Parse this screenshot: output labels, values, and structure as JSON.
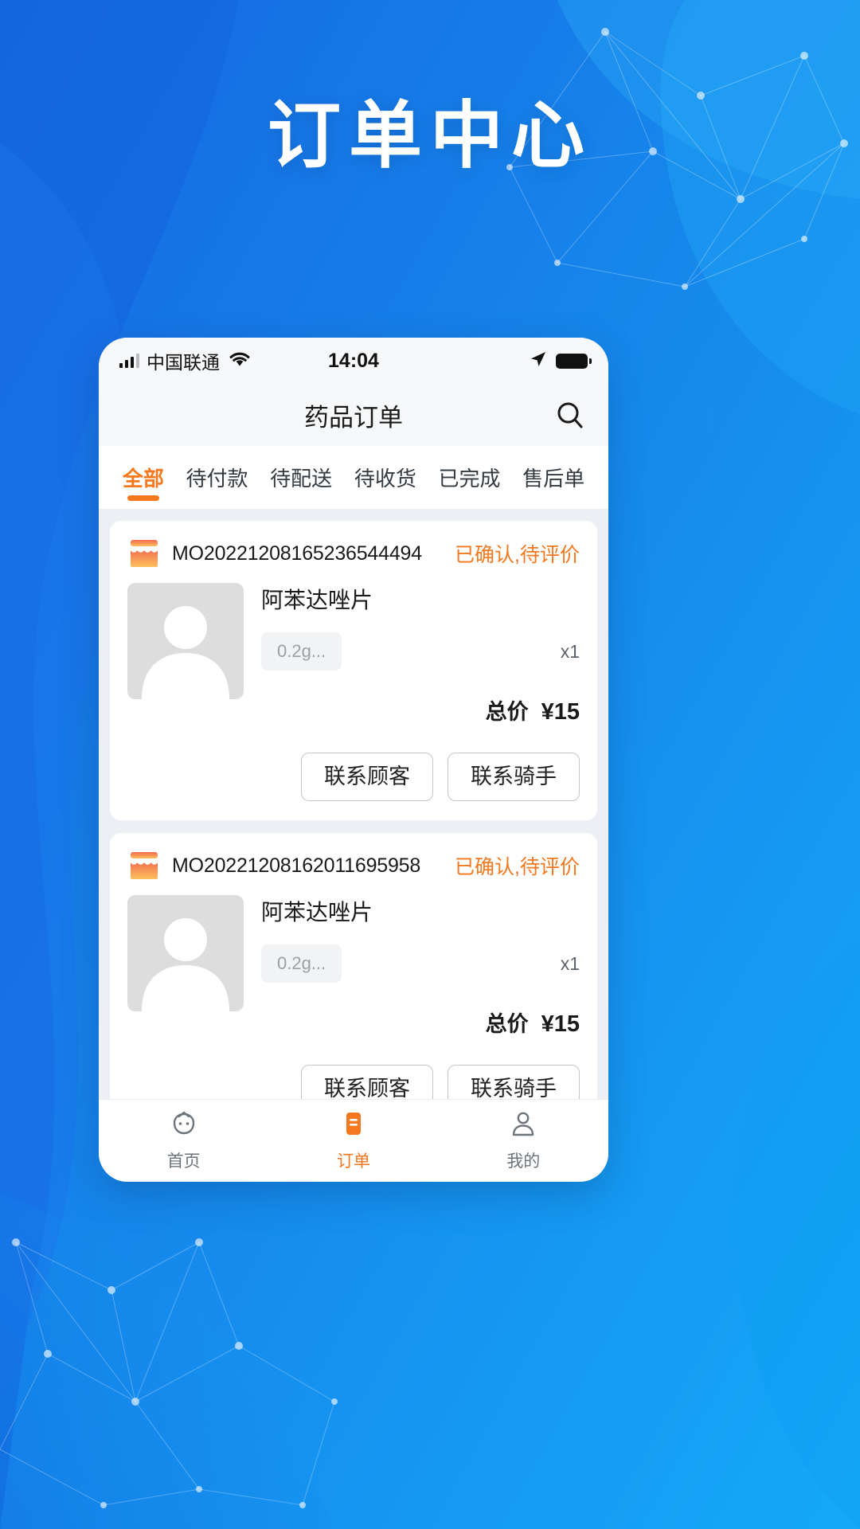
{
  "hero": {
    "title": "订单中心"
  },
  "theme": {
    "bg_start": "#1677e8",
    "bg_end": "#12b3fa",
    "accent": "#f5781f",
    "card_bg": "#ffffff",
    "list_bg": "#eceff4"
  },
  "status_bar": {
    "carrier": "中国联通",
    "time": "14:04",
    "signal_icon": "signal-bars-icon",
    "wifi_icon": "wifi-icon",
    "location_icon": "location-arrow-icon",
    "battery_icon": "battery-icon"
  },
  "app_bar": {
    "title": "药品订单",
    "search_icon": "search-icon"
  },
  "tabs": [
    {
      "label": "全部",
      "active": true
    },
    {
      "label": "待付款",
      "active": false
    },
    {
      "label": "待配送",
      "active": false
    },
    {
      "label": "待收货",
      "active": false
    },
    {
      "label": "已完成",
      "active": false
    },
    {
      "label": "售后单",
      "active": false
    }
  ],
  "orders": [
    {
      "shop_icon": "shop-icon",
      "order_no": "MO20221208165236544494",
      "status": "已确认,待评价",
      "product": {
        "name": "阿苯达唑片",
        "spec": "0.2g...",
        "quantity": "x1",
        "image_icon": "avatar-placeholder-icon"
      },
      "total_label": "总价",
      "total_value": "¥15",
      "buttons": [
        {
          "label": "联系顾客"
        },
        {
          "label": "联系骑手"
        }
      ]
    },
    {
      "shop_icon": "shop-icon",
      "order_no": "MO20221208162011695958",
      "status": "已确认,待评价",
      "product": {
        "name": "阿苯达唑片",
        "spec": "0.2g...",
        "quantity": "x1",
        "image_icon": "avatar-placeholder-icon"
      },
      "total_label": "总价",
      "total_value": "¥15",
      "buttons": [
        {
          "label": "联系顾客"
        },
        {
          "label": "联系骑手"
        }
      ]
    }
  ],
  "bottom_nav": [
    {
      "label": "首页",
      "icon": "home-icon",
      "active": false
    },
    {
      "label": "订单",
      "icon": "order-list-icon",
      "active": true
    },
    {
      "label": "我的",
      "icon": "user-icon",
      "active": false
    }
  ]
}
